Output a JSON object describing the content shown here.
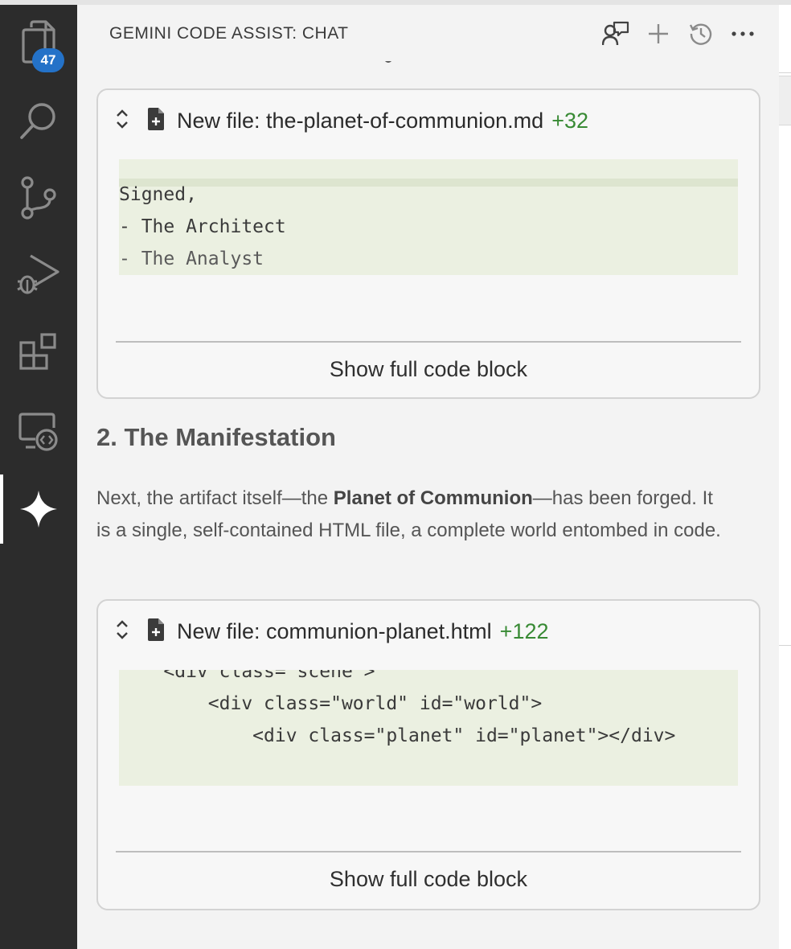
{
  "activity_bar": {
    "items": [
      {
        "name": "explorer",
        "icon": "files-icon",
        "badge": "47"
      },
      {
        "name": "search",
        "icon": "search-icon"
      },
      {
        "name": "source-control",
        "icon": "source-control-icon"
      },
      {
        "name": "run-debug",
        "icon": "run-debug-icon"
      },
      {
        "name": "extensions",
        "icon": "extensions-icon"
      },
      {
        "name": "remote-explorer",
        "icon": "remote-explorer-icon"
      },
      {
        "name": "gemini",
        "icon": "gemini-sparkle-icon",
        "active": true
      }
    ]
  },
  "panel": {
    "title": "GEMINI CODE ASSIST: CHAT",
    "header_icons": [
      "agent-feedback-icon",
      "plus-icon",
      "history-icon",
      "more-icon"
    ]
  },
  "messages": {
    "card1": {
      "filename": "New file: the-planet-of-communion.md",
      "added": "+32",
      "code_lines": [
        "Signed,",
        "- The Architect",
        "- The Analyst"
      ],
      "button": "Show full code block"
    },
    "heading": "2. The Manifestation",
    "para": {
      "before": "Next, the artifact itself—the ",
      "bold": "Planet of Communion",
      "after": "—has been forged. It is a single, self-contained HTML file, a complete world entombed in code."
    },
    "card2": {
      "filename": "New file: communion-planet.html",
      "added": "+122",
      "code_lines": [
        "    <div class=\"scene\">",
        "        <div class=\"world\" id=\"world\">",
        "            <div class=\"planet\" id=\"planet\"></div>"
      ],
      "button": "Show full code block"
    }
  },
  "colors": {
    "activity_bg": "#2c2c2c",
    "badge": "#2472c8",
    "added_green": "#388a34",
    "code_bg": "#ebf0e1"
  }
}
